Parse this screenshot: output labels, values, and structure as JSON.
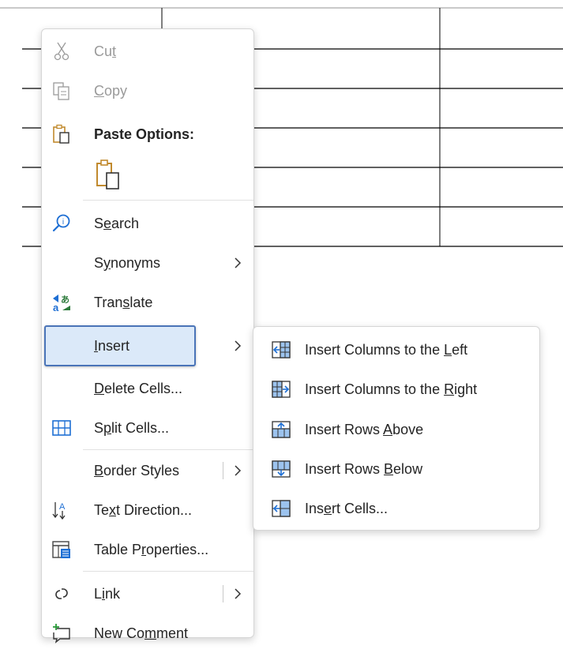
{
  "context_menu": {
    "items": [
      {
        "name": "cut",
        "pre": "Cu",
        "ul": "t",
        "post": ""
      },
      {
        "name": "copy",
        "pre": "",
        "ul": "C",
        "post": "opy"
      },
      {
        "name": "paste-options",
        "pre": "Paste Options:",
        "ul": "",
        "post": ""
      },
      {
        "name": "search",
        "pre": "S",
        "ul": "e",
        "post": "arch"
      },
      {
        "name": "synonyms",
        "pre": "S",
        "ul": "y",
        "post": "nonyms"
      },
      {
        "name": "translate",
        "pre": "Tran",
        "ul": "s",
        "post": "late"
      },
      {
        "name": "insert",
        "pre": "",
        "ul": "I",
        "post": "nsert"
      },
      {
        "name": "delete-cells",
        "pre": "",
        "ul": "D",
        "post": "elete Cells..."
      },
      {
        "name": "split-cells",
        "pre": "S",
        "ul": "p",
        "post": "lit Cells..."
      },
      {
        "name": "border-styles",
        "pre": "",
        "ul": "B",
        "post": "order Styles"
      },
      {
        "name": "text-direction",
        "pre": "Te",
        "ul": "x",
        "post": "t Direction..."
      },
      {
        "name": "table-properties",
        "pre": "Table P",
        "ul": "r",
        "post": "operties..."
      },
      {
        "name": "link",
        "pre": "L",
        "ul": "i",
        "post": "nk"
      },
      {
        "name": "new-comment",
        "pre": "New Co",
        "ul": "m",
        "post": "ment"
      }
    ]
  },
  "insert_submenu": {
    "items": [
      {
        "name": "insert-columns-left",
        "pre": "Insert Columns to the ",
        "ul": "L",
        "post": "eft"
      },
      {
        "name": "insert-columns-right",
        "pre": "Insert Columns to the ",
        "ul": "R",
        "post": "ight"
      },
      {
        "name": "insert-rows-above",
        "pre": "Insert Rows ",
        "ul": "A",
        "post": "bove"
      },
      {
        "name": "insert-rows-below",
        "pre": "Insert Rows ",
        "ul": "B",
        "post": "elow"
      },
      {
        "name": "insert-cells",
        "pre": "Ins",
        "ul": "e",
        "post": "rt Cells..."
      }
    ]
  },
  "colors": {
    "accent": "#4a74b8",
    "highlight": "#dbe9f9",
    "icon_blue": "#1e6fd4",
    "icon_gold": "#c18a2e"
  }
}
